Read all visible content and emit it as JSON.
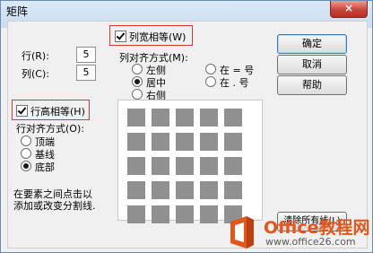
{
  "window": {
    "title": "矩阵",
    "close": "×"
  },
  "rows": {
    "label": "行(R):",
    "value": "5"
  },
  "cols": {
    "label": "列(C):",
    "value": "5"
  },
  "col_equal": {
    "label": "列宽相等(W)",
    "checked": true
  },
  "col_align": {
    "label": "列对齐方式(M):",
    "options": [
      "左侧",
      "居中",
      "右侧",
      "在 = 号",
      "在 . 号"
    ],
    "selected": "居中"
  },
  "row_equal": {
    "label": "行高相等(H)",
    "checked": true
  },
  "row_align": {
    "label": "行对齐方式(O):",
    "options": [
      "顶端",
      "基线",
      "底部"
    ],
    "selected": "底部"
  },
  "hint": {
    "line1": "在要素之间点击以",
    "line2": "添加或改变分割线."
  },
  "buttons": {
    "ok": "确定",
    "cancel": "取消",
    "help": "帮助",
    "clear": "清除所有线(L)"
  },
  "preview": {
    "rows": 5,
    "cols": 5
  },
  "watermark": {
    "brand": "Office教程网",
    "url": "www.office26.com"
  },
  "colors": {
    "highlight": "#d23a3a",
    "cell": "#909090",
    "brand": "#e2571e"
  }
}
